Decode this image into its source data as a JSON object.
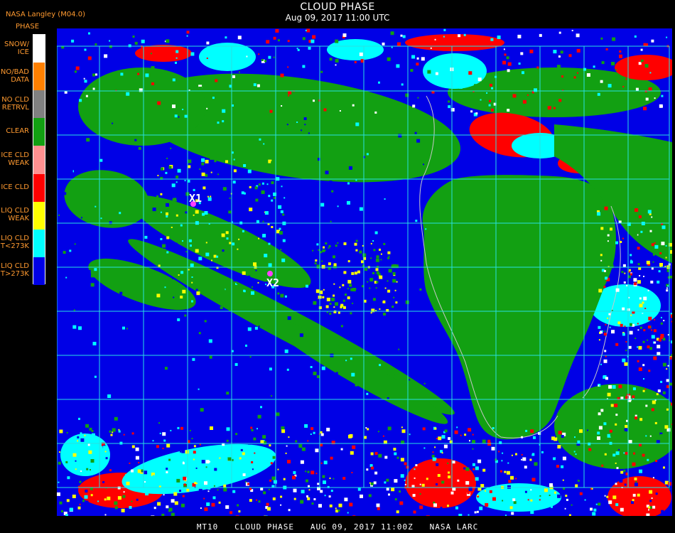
{
  "header": {
    "title": "CLOUD PHASE",
    "datetime": "Aug 09, 2017 11:00 UTC",
    "brand": "NASA Langley (M04.0)",
    "legend_heading": "PHASE"
  },
  "legend": [
    {
      "label": "SNOW/\nICE",
      "color": "#ffffff"
    },
    {
      "label": "NO/BAD\nDATA",
      "color": "#ff8000"
    },
    {
      "label": "NO CLD\nRETRVL",
      "color": "#808080"
    },
    {
      "label": "CLEAR",
      "color": "#12a012"
    },
    {
      "label": "ICE CLD\nWEAK",
      "color": "#ff9090"
    },
    {
      "label": "ICE CLD",
      "color": "#ff0000"
    },
    {
      "label": "LIQ CLD\nWEAK",
      "color": "#ffff00"
    },
    {
      "label": "LIQ CLD\nT<273K",
      "color": "#00ffff"
    },
    {
      "label": "LIQ CLD\nT>273K",
      "color": "#0000e6"
    }
  ],
  "markers": [
    {
      "label": "X1"
    },
    {
      "label": "X2"
    }
  ],
  "colors": {
    "grid": "#28e0e0",
    "coast": "#c8c8c8",
    "land": "#12a012",
    "water_cloud": "#0000e6",
    "ice_cloud": "#ff0000",
    "cold_liquid": "#00ffff",
    "weak_liquid": "#ffff00",
    "marker": "#ff40ff"
  },
  "footer": "MT10   CLOUD PHASE   AUG 09, 2017 11:00Z   NASA LARC"
}
